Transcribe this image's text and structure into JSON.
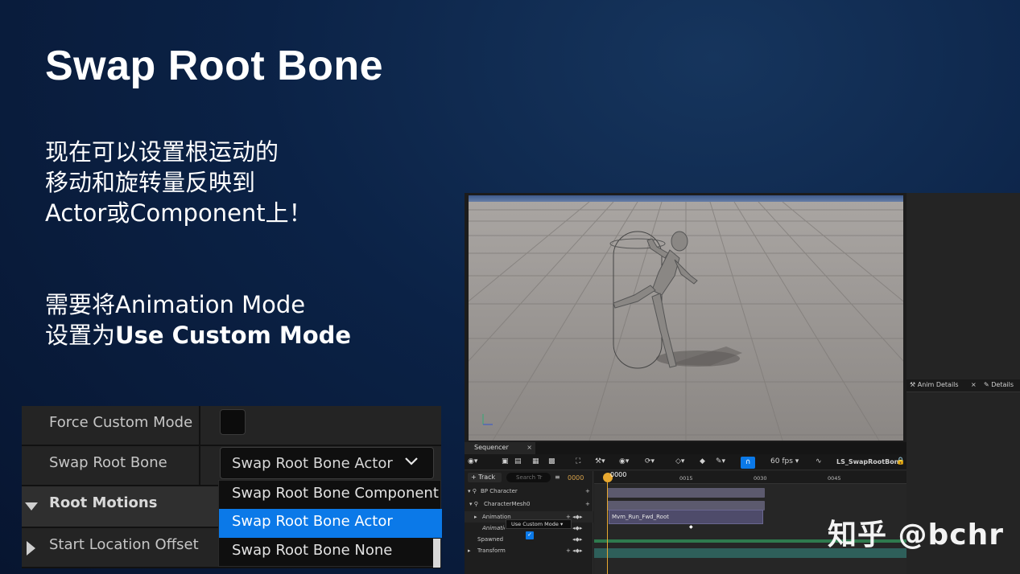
{
  "slide": {
    "title": "Swap Root Bone",
    "para1": [
      "现在可以设置根运动的",
      "移动和旋转量反映到",
      "Actor或Component上！"
    ],
    "para2_line1": "需要将Animation Mode",
    "para2_line2_prefix": "设置为",
    "para2_line2_bold": "Use Custom Mode"
  },
  "properties": {
    "force_custom_mode_label": "Force Custom Mode",
    "swap_root_bone_label": "Swap Root Bone",
    "swap_root_bone_value": "Swap Root Bone Actor",
    "root_motions_label": "Root Motions",
    "start_location_offset_label": "Start Location Offset",
    "dropdown_options": [
      "Swap Root Bone Component",
      "Swap Root Bone Actor",
      "Swap Root Bone None"
    ],
    "selected_option": "Swap Root Bone Actor"
  },
  "editor": {
    "right_tabs": [
      "Anim Details",
      "Details"
    ],
    "sequencer_tab": "Sequencer",
    "fps": "60 fps",
    "sequence_name": "LS_SwapRootBone",
    "track_button": "Track",
    "search_placeholder": "Search Tr",
    "frame": "0000",
    "ruler_labels": [
      "0000",
      "0015",
      "0030",
      "0045"
    ],
    "tracks": [
      "BP Character",
      "CharacterMesh0",
      "Animation",
      "Animation Mode",
      "Spawned",
      "Transform"
    ],
    "animation_mode_value": "Use Custom Mode",
    "clip_name": "Mvm_Run_Fwd_Root"
  },
  "watermark": "知乎 @bchr",
  "colors": {
    "accent": "#0b79e8",
    "background": "#0b2246",
    "playhead": "#e8a830"
  }
}
